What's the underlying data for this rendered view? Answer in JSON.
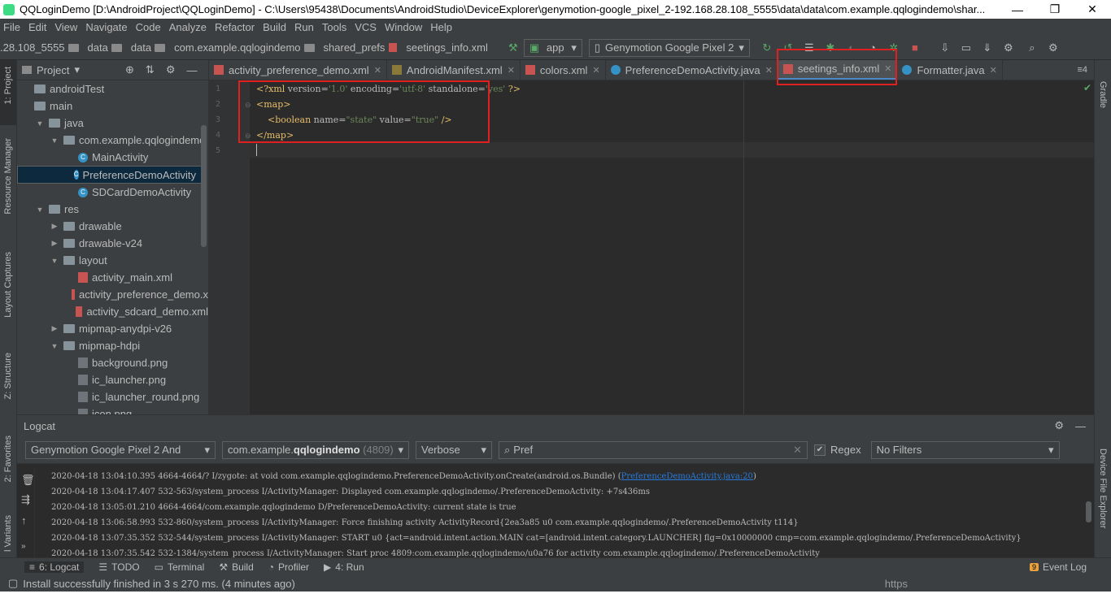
{
  "window": {
    "title": "QQLoginDemo [D:\\AndroidProject\\QQLoginDemo] - C:\\Users\\95438\\Documents\\AndroidStudio\\DeviceExplorer\\genymotion-google_pixel_2-192.168.28.108_5555\\data\\data\\com.example.qqlogindemo\\shar...",
    "minimize": "—",
    "maximize": "❐",
    "close": "✕"
  },
  "menu": [
    "File",
    "Edit",
    "View",
    "Navigate",
    "Code",
    "Analyze",
    "Refactor",
    "Build",
    "Run",
    "Tools",
    "VCS",
    "Window",
    "Help"
  ],
  "breadcrumbs": [
    ".28.108_5555",
    "data",
    "data",
    "com.example.qqlogindemo",
    "shared_prefs",
    "seetings_info.xml"
  ],
  "toolbar": {
    "run_config": "app",
    "device": "Genymotion Google Pixel 2"
  },
  "left_strip": [
    "1: Project",
    "Resource Manager",
    "Layout Captures",
    "Z: Structure",
    "2: Favorites",
    "l Variants"
  ],
  "right_strip": [
    "Gradle",
    "Device File Explorer"
  ],
  "project": {
    "header": "Project",
    "tree": [
      {
        "label": "androidTest",
        "level": 0,
        "type": "folder",
        "arrow": ""
      },
      {
        "label": "main",
        "level": 0,
        "type": "folder",
        "arrow": ""
      },
      {
        "label": "java",
        "level": 1,
        "type": "folder",
        "arrow": "▼"
      },
      {
        "label": "com.example.qqlogindemo",
        "level": 2,
        "type": "folder",
        "arrow": "▼"
      },
      {
        "label": "MainActivity",
        "level": 3,
        "type": "class",
        "arrow": ""
      },
      {
        "label": "PreferenceDemoActivity",
        "level": 3,
        "type": "class",
        "arrow": "",
        "selected": true
      },
      {
        "label": "SDCardDemoActivity",
        "level": 3,
        "type": "class",
        "arrow": ""
      },
      {
        "label": "res",
        "level": 1,
        "type": "folder",
        "arrow": "▼"
      },
      {
        "label": "drawable",
        "level": 2,
        "type": "folder",
        "arrow": "▶"
      },
      {
        "label": "drawable-v24",
        "level": 2,
        "type": "folder",
        "arrow": "▶"
      },
      {
        "label": "layout",
        "level": 2,
        "type": "folder",
        "arrow": "▼"
      },
      {
        "label": "activity_main.xml",
        "level": 3,
        "type": "xml",
        "arrow": ""
      },
      {
        "label": "activity_preference_demo.x",
        "level": 3,
        "type": "xml",
        "arrow": ""
      },
      {
        "label": "activity_sdcard_demo.xml",
        "level": 3,
        "type": "xml",
        "arrow": ""
      },
      {
        "label": "mipmap-anydpi-v26",
        "level": 2,
        "type": "folder",
        "arrow": "▶"
      },
      {
        "label": "mipmap-hdpi",
        "level": 2,
        "type": "folder",
        "arrow": "▼"
      },
      {
        "label": "background.png",
        "level": 3,
        "type": "png",
        "arrow": ""
      },
      {
        "label": "ic_launcher.png",
        "level": 3,
        "type": "png",
        "arrow": ""
      },
      {
        "label": "ic_launcher_round.png",
        "level": 3,
        "type": "png",
        "arrow": ""
      },
      {
        "label": "icon.png",
        "level": 3,
        "type": "png",
        "arrow": ""
      }
    ]
  },
  "tabs": [
    {
      "label": "activity_preference_demo.xml",
      "icon": "xml",
      "active": false
    },
    {
      "label": "AndroidManifest.xml",
      "icon": "manifest",
      "active": false
    },
    {
      "label": "colors.xml",
      "icon": "xml",
      "active": false
    },
    {
      "label": "PreferenceDemoActivity.java",
      "icon": "class",
      "active": false
    },
    {
      "label": "seetings_info.xml",
      "icon": "xml",
      "active": true
    },
    {
      "label": "Formatter.java",
      "icon": "class",
      "active": false
    }
  ],
  "tabs_more": "≡4",
  "editor": {
    "line_numbers": [
      "1",
      "2",
      "3",
      "4",
      "5"
    ]
  },
  "logcat": {
    "title": "Logcat",
    "device": "Genymotion Google Pixel 2 And",
    "process_prefix": "com.example.",
    "process_bold": "qqlogindemo",
    "process_pid": "(4809)",
    "level": "Verbose",
    "search": "Pref",
    "regex_label": "Regex",
    "filter": "No Filters",
    "lines": [
      {
        "text": "2020-04-18 13:04:10.395 4664-4664/? I/zygote:     at void com.example.qqlogindemo.PreferenceDemoActivity.onCreate(android.os.Bundle) (",
        "link": "PreferenceDemoActivity.java:20",
        "tail": ")"
      },
      {
        "text": "2020-04-18 13:04:17.407 532-563/system_process I/ActivityManager: Displayed com.example.qqlogindemo/.PreferenceDemoActivity: +7s436ms",
        "link": "",
        "tail": ""
      },
      {
        "text": "2020-04-18 13:05:01.210 4664-4664/com.example.qqlogindemo D/PreferenceDemoActivity: current state is true",
        "link": "",
        "tail": ""
      },
      {
        "text": "2020-04-18 13:06:58.993 532-860/system_process I/ActivityManager:   Force finishing activity ActivityRecord{2ea3a85 u0 com.example.qqlogindemo/.PreferenceDemoActivity t114}",
        "link": "",
        "tail": ""
      },
      {
        "text": "2020-04-18 13:07:35.352 532-544/system_process I/ActivityManager: START u0 {act=android.intent.action.MAIN cat=[android.intent.category.LAUNCHER] flg=0x10000000 cmp=com.example.qqlogindemo/.PreferenceDemoActivity}",
        "link": "",
        "tail": ""
      },
      {
        "text": "2020-04-18 13:07:35.542 532-1384/system_process I/ActivityManager: Start proc 4809:com.example.qqlogindemo/u0a76 for activity com.example.qqlogindemo/.PreferenceDemoActivity",
        "link": "",
        "tail": ""
      }
    ]
  },
  "bottom_tabs": [
    {
      "label": "6: Logcat",
      "active": true
    },
    {
      "label": "TODO",
      "active": false
    },
    {
      "label": "Terminal",
      "active": false
    },
    {
      "label": "Build",
      "active": false
    },
    {
      "label": "Profiler",
      "active": false
    },
    {
      "label": "4: Run",
      "active": false
    }
  ],
  "event_log": "Event Log",
  "event_log_badge": "9",
  "status": "Install successfully finished in 3 s 270 ms. (4 minutes ago)",
  "watermark": "https",
  "colors": {
    "accent": "#4a88c7",
    "highlight": "#e02020",
    "selection": "#0d293e"
  }
}
